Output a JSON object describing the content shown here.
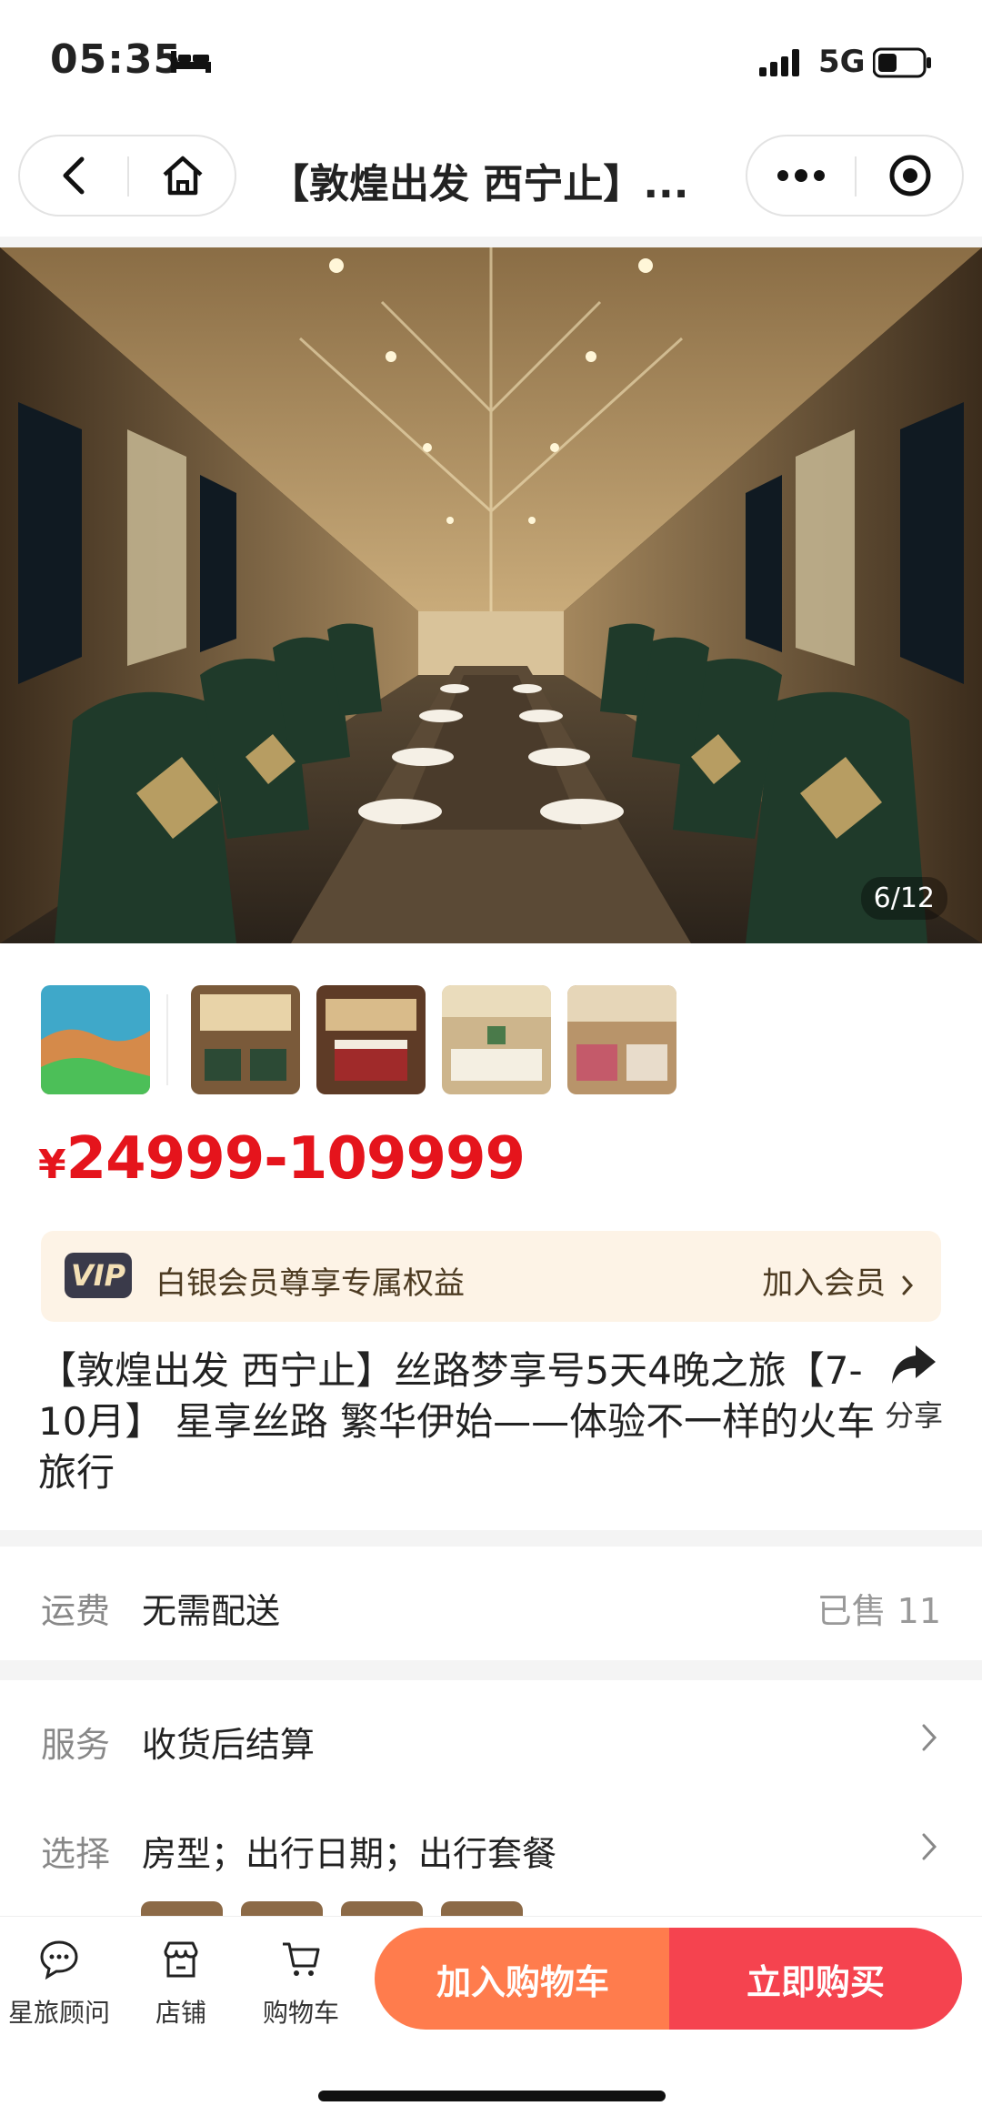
{
  "status_bar": {
    "time": "05:35",
    "network": "5G"
  },
  "nav": {
    "title": "【敦煌出发 西宁止】..."
  },
  "gallery": {
    "counter": "6/12"
  },
  "product": {
    "currency": "¥",
    "price": "24999-109999",
    "vip_badge": "VIP",
    "vip_text": "白银会员尊享专属权益",
    "vip_join": "加入会员",
    "title": "【敦煌出发 西宁止】丝路梦享号5天4晚之旅【7-10月】 星享丝路 繁华伊始——体验不一样的火车旅行",
    "share_label": "分享"
  },
  "shipping": {
    "label": "运费",
    "value": "无需配送",
    "sold": "已售 11"
  },
  "service": {
    "label": "服务",
    "value": "收货后结算"
  },
  "options": {
    "label": "选择",
    "value": "房型；出行日期；出行套餐"
  },
  "bottom_bar": {
    "tabs": [
      {
        "label": "星旅顾问",
        "icon": "chat-icon"
      },
      {
        "label": "店铺",
        "icon": "store-icon"
      },
      {
        "label": "购物车",
        "icon": "cart-icon"
      }
    ],
    "add_to_cart": "加入购物车",
    "buy_now": "立即购买"
  },
  "colors": {
    "price": "#e5141c",
    "cart_button": "#ff7c4d",
    "buy_button": "#f5434f",
    "vip_bg": "#fdf3e6"
  }
}
